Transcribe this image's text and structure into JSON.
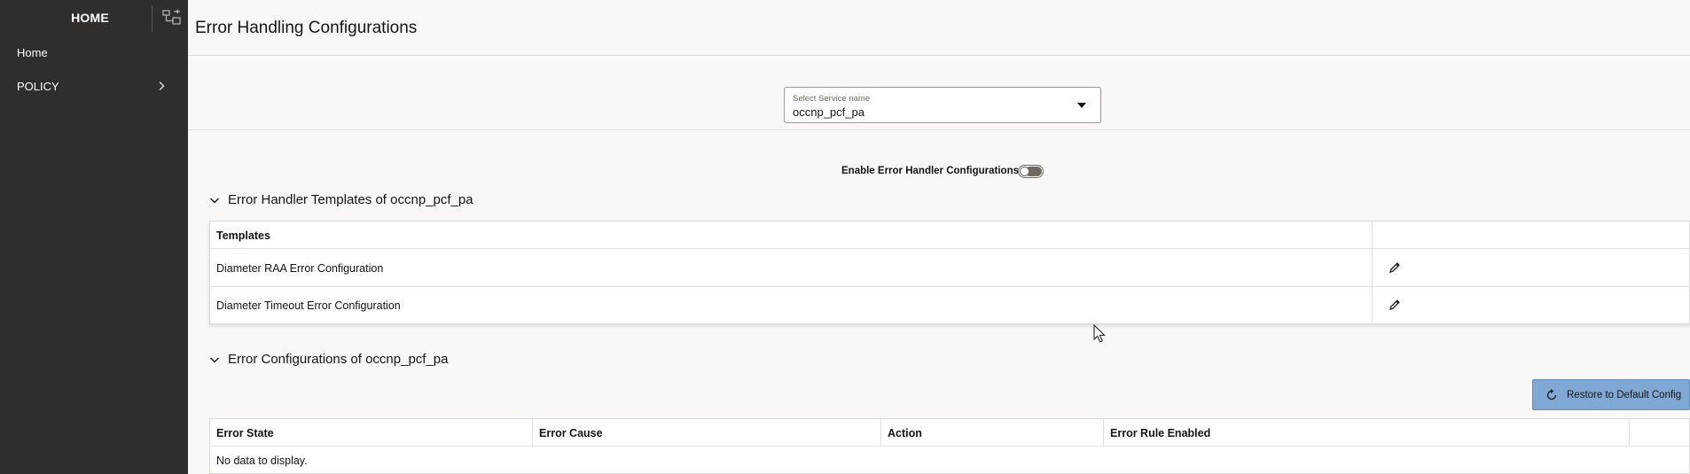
{
  "sidebar": {
    "title": "HOME",
    "items": [
      {
        "label": "Home"
      },
      {
        "label": "POLICY"
      }
    ]
  },
  "header": {
    "title": "Error Handling Configurations"
  },
  "service_select": {
    "label": "Select Service name",
    "value": "occnp_pcf_pa"
  },
  "toggle": {
    "label": "Enable Error Handler Configurations",
    "enabled": false
  },
  "templates_section": {
    "title": "Error Handler Templates of occnp_pcf_pa",
    "column": "Templates",
    "rows": [
      {
        "name": "Diameter RAA Error Configuration"
      },
      {
        "name": "Diameter Timeout Error Configuration"
      }
    ]
  },
  "config_section": {
    "title": "Error Configurations of occnp_pcf_pa",
    "restore_label": "Restore to Default Config",
    "columns": [
      "Error State",
      "Error Cause",
      "Action",
      "Error Rule Enabled"
    ],
    "empty_text": "No data to display."
  },
  "icons": {
    "collapse": "sidebar-collapse-icon",
    "chevron": "chevron-right-icon",
    "edit": "pencil-icon",
    "restore": "refresh-icon"
  },
  "colors": {
    "sidebar_bg": "#312d2a",
    "page_bg": "#f9f8f6",
    "restore_button_bg": "#7fa8d4"
  }
}
